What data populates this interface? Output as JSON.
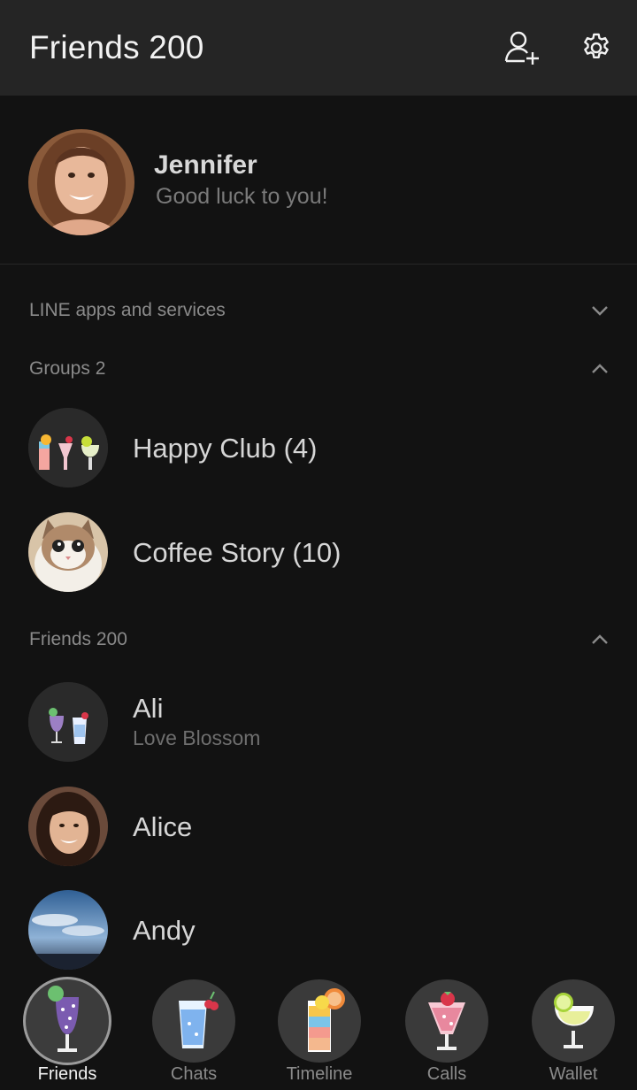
{
  "header": {
    "title": "Friends 200"
  },
  "profile": {
    "name": "Jennifer",
    "status": "Good luck to you!"
  },
  "sections": {
    "services": "LINE apps and services",
    "groups": "Groups 2",
    "friends": "Friends 200"
  },
  "groups": [
    {
      "name": "Happy Club (4)"
    },
    {
      "name": "Coffee Story (10)"
    }
  ],
  "friends": [
    {
      "name": "Ali",
      "status": "Love Blossom"
    },
    {
      "name": "Alice"
    },
    {
      "name": "Andy"
    }
  ],
  "nav": [
    {
      "label": "Friends",
      "active": true
    },
    {
      "label": "Chats"
    },
    {
      "label": "Timeline"
    },
    {
      "label": "Calls"
    },
    {
      "label": "Wallet"
    }
  ],
  "colors": {
    "background": "#121212",
    "header": "#252525",
    "accent_text": "#f2f2f2"
  }
}
